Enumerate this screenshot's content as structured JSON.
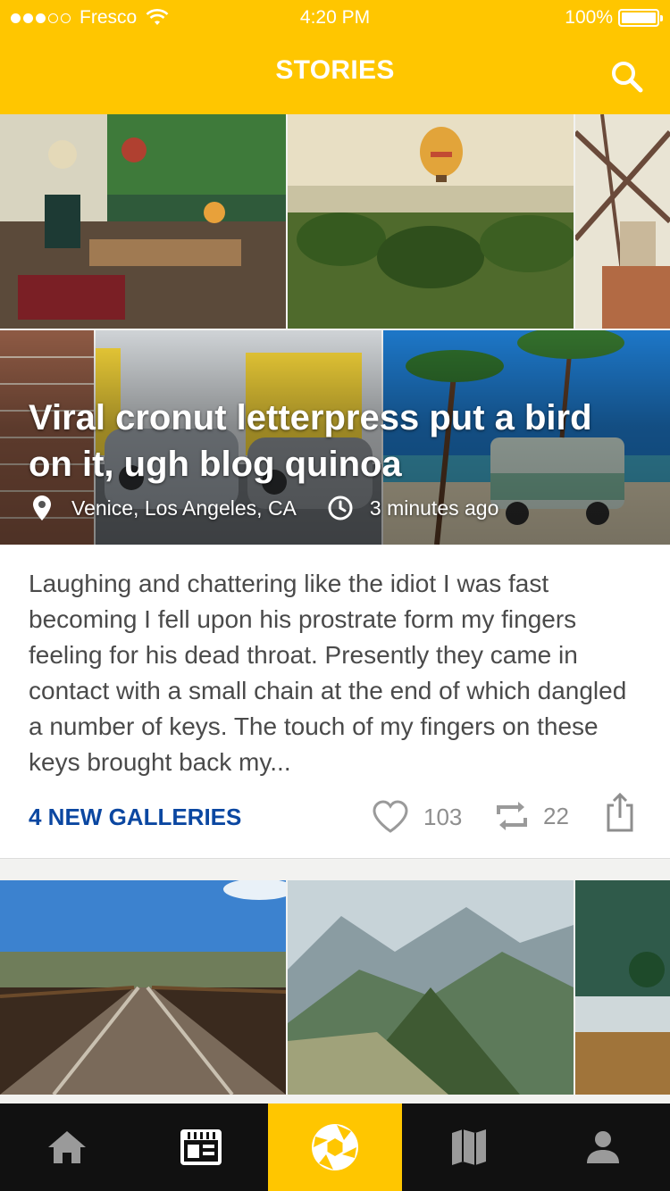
{
  "status_bar": {
    "carrier": "Fresco",
    "time": "4:20 PM",
    "battery": "100%"
  },
  "header": {
    "title": "STORIES"
  },
  "story": {
    "headline": "Viral cronut letterpress put a bird on it, ugh blog quinoa",
    "location": "Venice, Los Angeles, CA",
    "time_ago": "3 minutes ago",
    "body": "Laughing and chattering like the idiot I was fast becoming I fell upon his prostrate form my fingers feeling for his dead throat. Presently they came in contact with a small chain at the end of which dangled a number of keys. The touch of my fingers on these keys brought back my...",
    "galleries_link": "4 NEW GALLERIES",
    "likes": "103",
    "reposts": "22"
  },
  "tabs": [
    {
      "icon": "home-icon"
    },
    {
      "icon": "news-icon"
    },
    {
      "icon": "camera-aperture-icon",
      "active": true
    },
    {
      "icon": "map-icon"
    },
    {
      "icon": "profile-icon"
    }
  ],
  "colors": {
    "accent": "#ffc600",
    "link": "#0b47a1",
    "tabbar": "#111111",
    "body_text": "#4a4a4a"
  }
}
